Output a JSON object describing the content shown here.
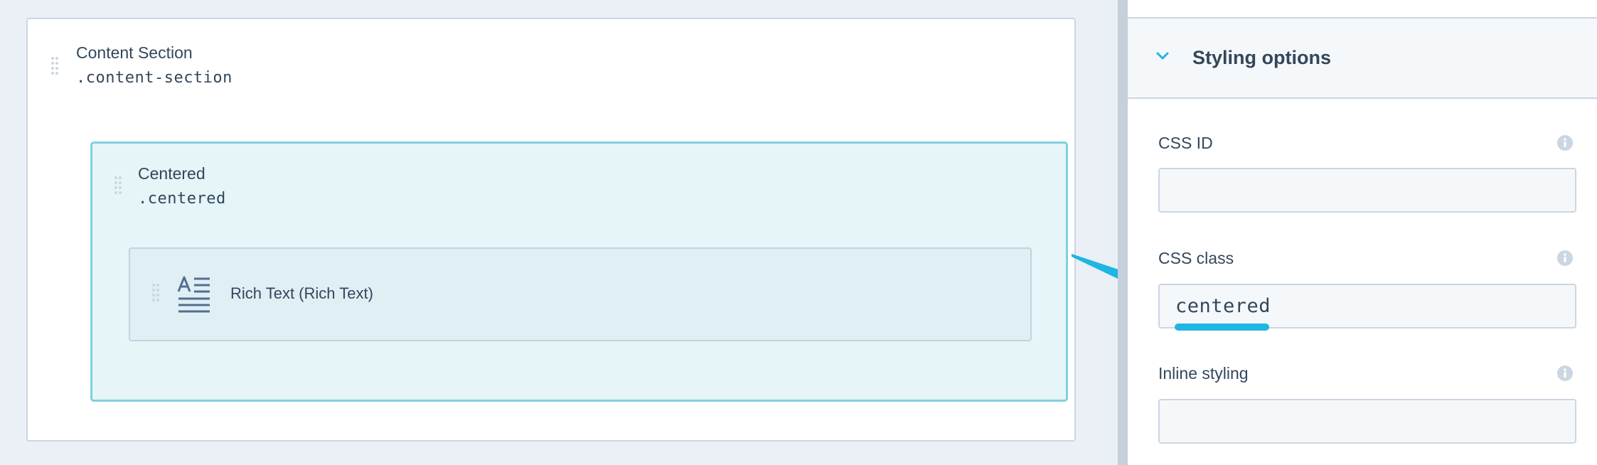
{
  "canvas": {
    "section": {
      "name": "Content Section",
      "class": ".content-section"
    },
    "centered": {
      "name": "Centered",
      "class": ".centered"
    },
    "module": {
      "label": "Rich Text (Rich Text)",
      "icon": "rich-text-icon"
    }
  },
  "panel": {
    "title": "Styling options",
    "fields": {
      "css_id": {
        "label": "CSS ID",
        "value": ""
      },
      "css_class": {
        "label": "CSS class",
        "value": "centered"
      },
      "inline_styling": {
        "label": "Inline styling",
        "value": ""
      }
    }
  },
  "colors": {
    "accent": "#1fb6e3",
    "highlight_border": "#7fd1de",
    "highlight_bg": "#e5f5f8",
    "text": "#33475b"
  }
}
